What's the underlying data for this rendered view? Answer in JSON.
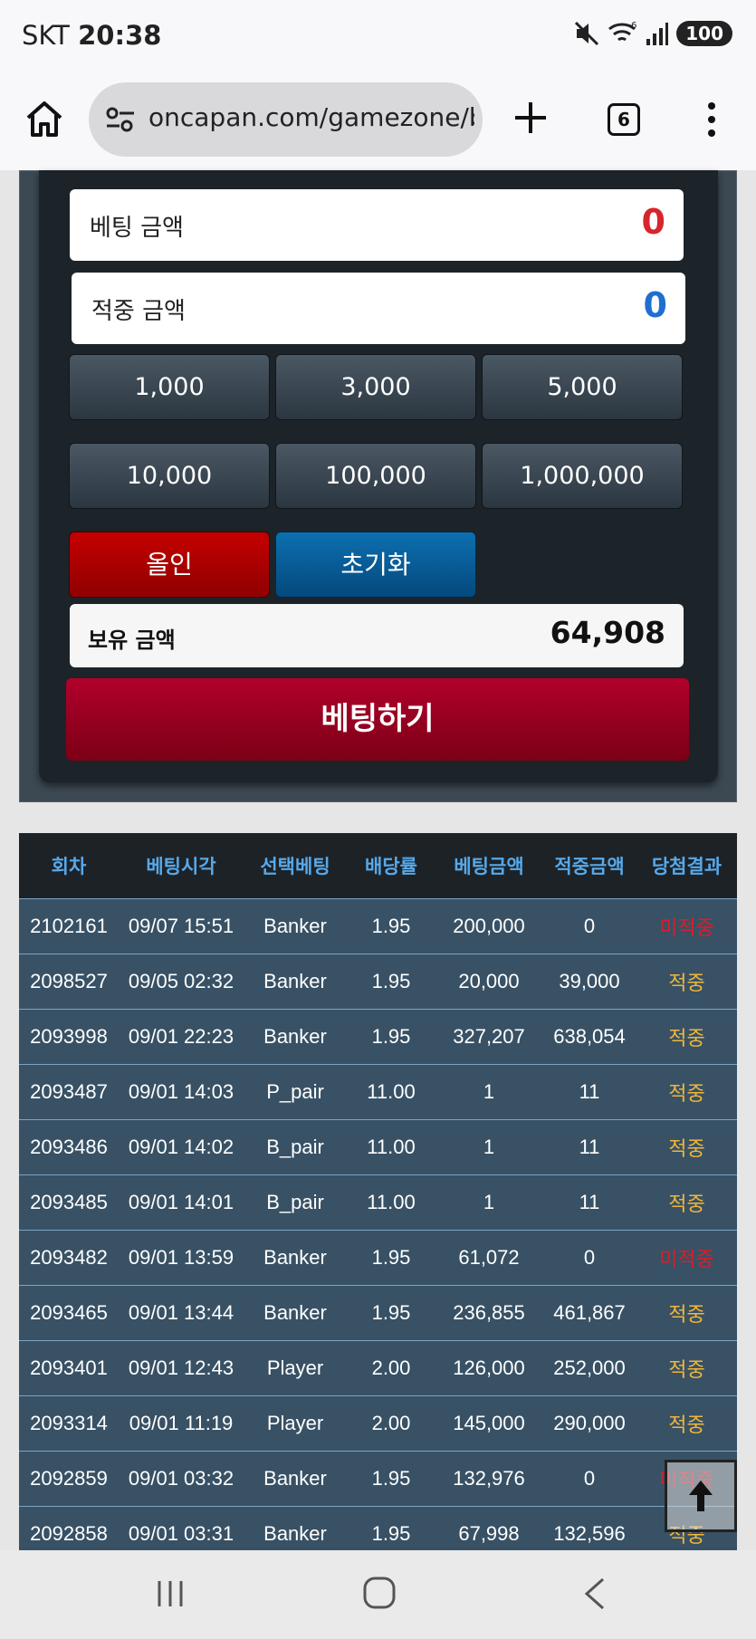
{
  "status_bar": {
    "carrier": "SKT",
    "time": "20:38",
    "battery": "100",
    "wifi_badge": "6"
  },
  "browser": {
    "url": "oncapan.com/gamezone/ba",
    "tab_count": "6"
  },
  "betting": {
    "bet_amount_label": "베팅 금액",
    "bet_amount_value": "0",
    "win_amount_label": "적중 금액",
    "win_amount_value": "0",
    "chips": [
      "1,000",
      "3,000",
      "5,000",
      "10,000",
      "100,000",
      "1,000,000"
    ],
    "allin_label": "올인",
    "reset_label": "초기화",
    "holding_label": "보유 금액",
    "holding_value": "64,908",
    "submit_label": "베팅하기",
    "colors": {
      "bet_value": "#d6262b",
      "win_value": "#1f6fd0",
      "allin": "#b50000",
      "reset": "#0a5d97",
      "submit": "#9a0022"
    }
  },
  "history": {
    "columns": [
      "회차",
      "베팅시각",
      "선택베팅",
      "배당률",
      "베팅금액",
      "적중금액",
      "당첨결과"
    ],
    "rows": [
      [
        "2102161",
        "09/07 15:51",
        "Banker",
        "1.95",
        "200,000",
        "0",
        "미적중"
      ],
      [
        "2098527",
        "09/05 02:32",
        "Banker",
        "1.95",
        "20,000",
        "39,000",
        "적중"
      ],
      [
        "2093998",
        "09/01 22:23",
        "Banker",
        "1.95",
        "327,207",
        "638,054",
        "적중"
      ],
      [
        "2093487",
        "09/01 14:03",
        "P_pair",
        "11.00",
        "1",
        "11",
        "적중"
      ],
      [
        "2093486",
        "09/01 14:02",
        "B_pair",
        "11.00",
        "1",
        "11",
        "적중"
      ],
      [
        "2093485",
        "09/01 14:01",
        "B_pair",
        "11.00",
        "1",
        "11",
        "적중"
      ],
      [
        "2093482",
        "09/01 13:59",
        "Banker",
        "1.95",
        "61,072",
        "0",
        "미적중"
      ],
      [
        "2093465",
        "09/01 13:44",
        "Banker",
        "1.95",
        "236,855",
        "461,867",
        "적중"
      ],
      [
        "2093401",
        "09/01 12:43",
        "Player",
        "2.00",
        "126,000",
        "252,000",
        "적중"
      ],
      [
        "2093314",
        "09/01 11:19",
        "Player",
        "2.00",
        "145,000",
        "290,000",
        "적중"
      ],
      [
        "2092859",
        "09/01 03:32",
        "Banker",
        "1.95",
        "132,976",
        "0",
        "미적중"
      ],
      [
        "2092858",
        "09/01 03:31",
        "Banker",
        "1.95",
        "67,998",
        "132,596",
        "적중"
      ]
    ],
    "result_colors": {
      "win": "#f0b63a",
      "lose": "#d81e2b"
    }
  },
  "icons": {
    "home": "home-icon",
    "tune": "tune-icon",
    "plus": "plus-icon",
    "tabs": "tabs-icon",
    "more": "more-vertical-icon",
    "mute": "mute-icon",
    "wifi": "wifi-icon",
    "signal": "signal-icon",
    "scroll_top": "arrow-up-icon",
    "nav_recent": "recent-apps-icon",
    "nav_home": "nav-home-icon",
    "nav_back": "back-icon"
  }
}
